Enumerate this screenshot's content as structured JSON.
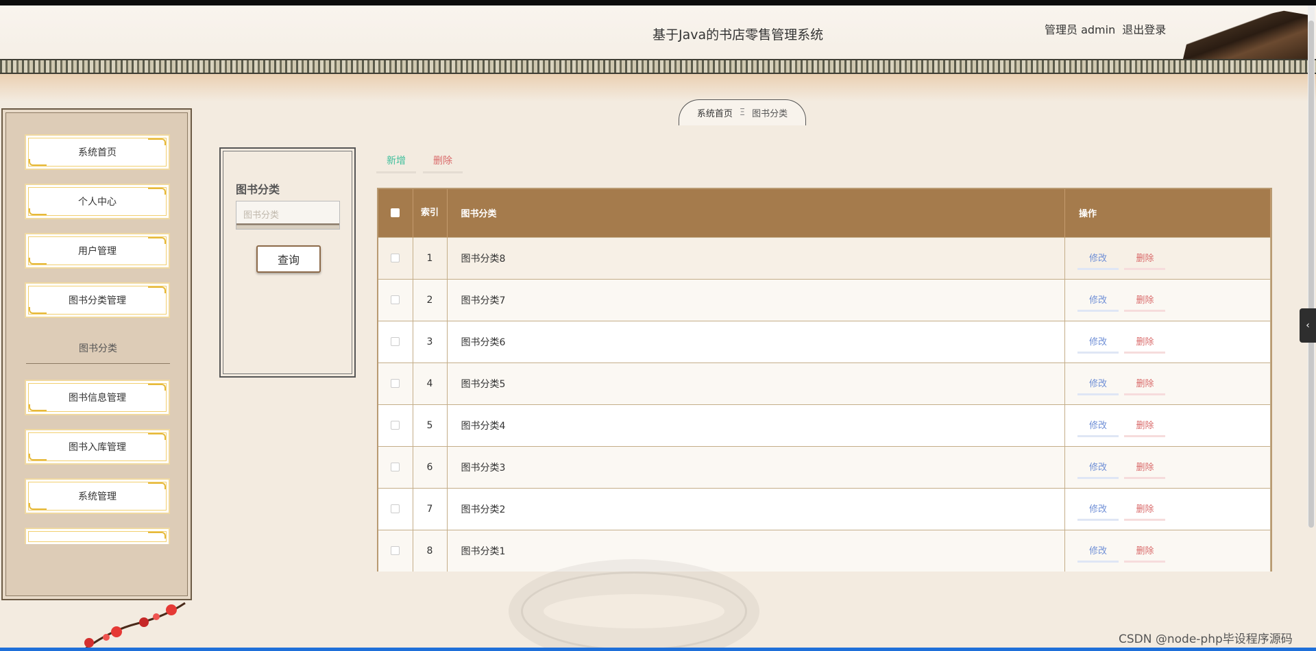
{
  "header": {
    "title": "基于Java的书店零售管理系统",
    "user_label": "管理员 admin",
    "logout_label": "退出登录"
  },
  "breadcrumb": {
    "home": "系统首页",
    "separator": "Ξ",
    "current": "图书分类"
  },
  "sidebar": {
    "items": [
      {
        "label": "系统首页"
      },
      {
        "label": "个人中心"
      },
      {
        "label": "用户管理"
      },
      {
        "label": "图书分类管理"
      },
      {
        "label": "图书信息管理"
      },
      {
        "label": "图书入库管理"
      },
      {
        "label": "系统管理"
      }
    ],
    "sub_item": "图书分类"
  },
  "search": {
    "label": "图书分类",
    "placeholder": "图书分类",
    "button": "查询"
  },
  "actions": {
    "add": "新增",
    "delete": "删除"
  },
  "table": {
    "headers": {
      "index": "索引",
      "name": "图书分类",
      "ops": "操作"
    },
    "rows": [
      {
        "index": "1",
        "name": "图书分类8"
      },
      {
        "index": "2",
        "name": "图书分类7"
      },
      {
        "index": "3",
        "name": "图书分类6"
      },
      {
        "index": "4",
        "name": "图书分类5"
      },
      {
        "index": "5",
        "name": "图书分类4"
      },
      {
        "index": "6",
        "name": "图书分类3"
      },
      {
        "index": "7",
        "name": "图书分类2"
      },
      {
        "index": "8",
        "name": "图书分类1"
      }
    ],
    "row_actions": {
      "edit": "修改",
      "delete": "删除"
    }
  },
  "watermark": "CSDN @node-php毕设程序源码",
  "colors": {
    "table_header": "#a57b4c",
    "add": "#3fbf9c",
    "delete": "#d96a6a",
    "edit": "#6f8fd6"
  }
}
